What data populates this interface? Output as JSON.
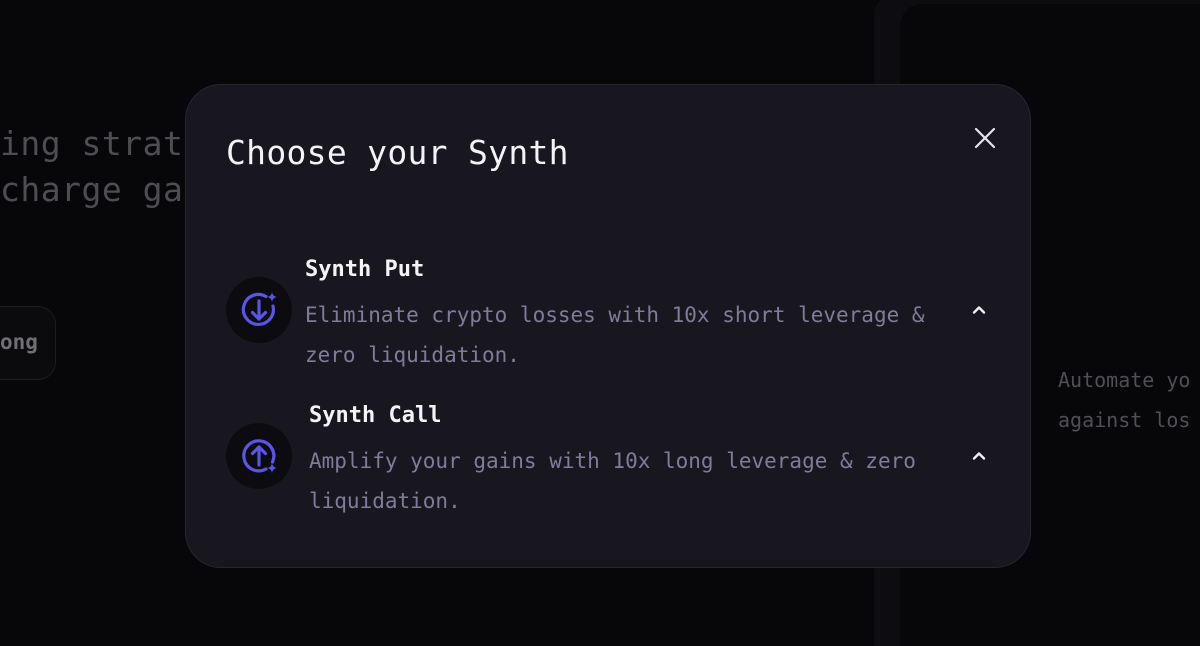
{
  "background": {
    "hero_line_1": "ing strate",
    "hero_line_2": "charge gai",
    "pill_label": "ong",
    "panel_line_1": "Automate yo",
    "panel_line_2": "against los"
  },
  "modal": {
    "title": "Choose your Synth",
    "close_icon": "close-icon",
    "options": [
      {
        "title": "Synth Put",
        "description": "Eliminate crypto losses with 10x short leverage & zero liquidation.",
        "icon": "arrow-down-sparkle-icon",
        "chevron": "chevron-up-icon"
      },
      {
        "title": "Synth Call",
        "description": "Amplify your gains with 10x long leverage & zero liquidation.",
        "icon": "arrow-up-sparkle-icon",
        "chevron": "chevron-up-icon"
      }
    ]
  },
  "colors": {
    "accent": "#5b54e6",
    "modal_bg": "#18171f",
    "muted_text": "#807b9a"
  }
}
